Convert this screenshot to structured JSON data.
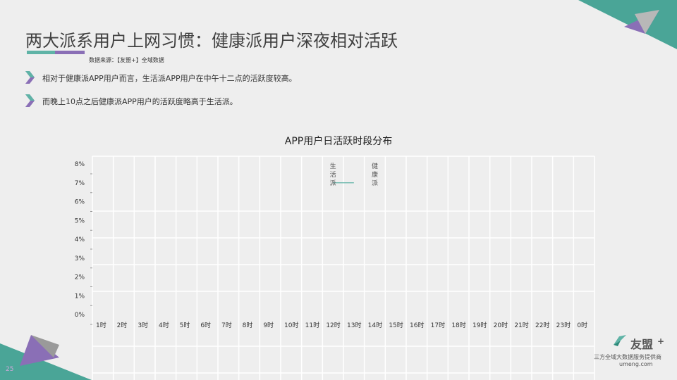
{
  "slide": {
    "title": "两大派系用户上网习惯：健康派用户深夜相对活跃",
    "source": "数据来源：【友盟+】全域数据",
    "bullets": [
      "相对于健康派APP用户而言，生活派APP用户在中午十二点的活跃度较高。",
      "而晚上10点之后健康派APP用户的活跃度略高于生活派。"
    ],
    "page_number": "25"
  },
  "brand": {
    "name": "友盟",
    "plus": "+",
    "tagline": "三方全域大数据服务提供商",
    "url": "umeng.com"
  },
  "colors": {
    "teal": "#5fb3a6",
    "purple": "#8a6fb6",
    "dark_teal": "#2d8a7a",
    "grid": "#ffffff"
  },
  "icons": [
    "chevron-right-icon",
    "umeng-logo-icon"
  ],
  "chart_data": {
    "type": "line",
    "title": "APP用户日活跃时段分布",
    "categories": [
      "1时",
      "2时",
      "3时",
      "4时",
      "5时",
      "6时",
      "7时",
      "8时",
      "9时",
      "10时",
      "11时",
      "12时",
      "13时",
      "14时",
      "15时",
      "16时",
      "17时",
      "18时",
      "19时",
      "20时",
      "21时",
      "22时",
      "23时",
      "0时"
    ],
    "y_ticks": [
      "8%",
      "7%",
      "6%",
      "5%",
      "4%",
      "3%",
      "2%",
      "1%",
      "0%"
    ],
    "ylim": [
      0,
      8
    ],
    "grid": true,
    "series": [
      {
        "name": "生活派",
        "color": "#5fb3a6",
        "values": [
          null,
          null,
          null,
          null,
          null,
          null,
          null,
          null,
          null,
          null,
          null,
          7,
          7,
          null,
          null,
          null,
          null,
          null,
          null,
          null,
          null,
          null,
          null,
          null
        ]
      },
      {
        "name": "健康派",
        "color": "#8a6fb6",
        "values": []
      }
    ],
    "legend_placement": "inside-top"
  }
}
